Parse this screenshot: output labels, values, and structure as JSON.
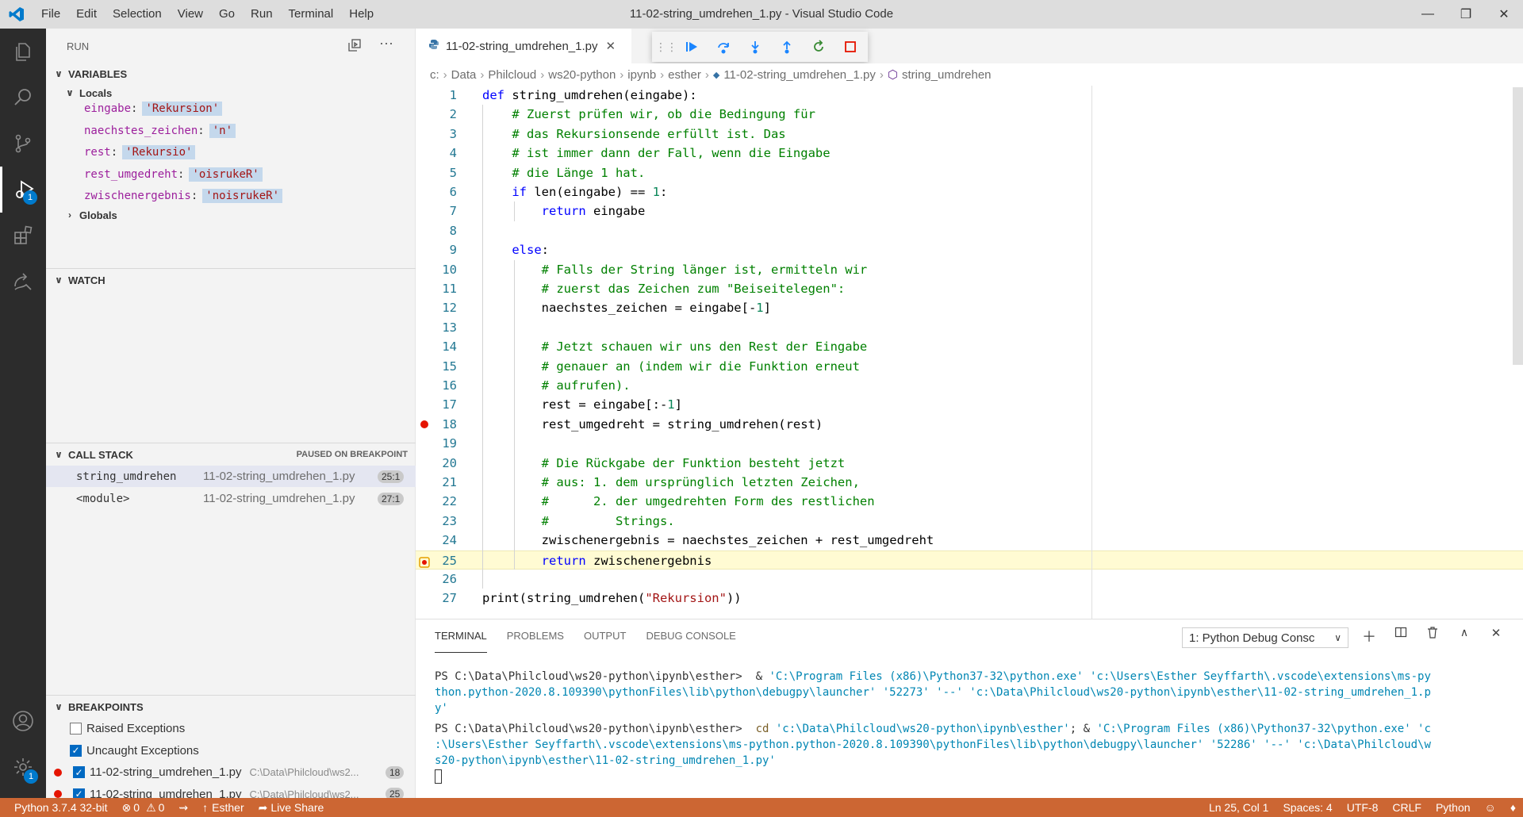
{
  "titlebar": {
    "menu": [
      "File",
      "Edit",
      "Selection",
      "View",
      "Go",
      "Run",
      "Terminal",
      "Help"
    ],
    "title": "11-02-string_umdrehen_1.py - Visual Studio Code"
  },
  "activity": {
    "run_badge": "1",
    "settings_badge": "1"
  },
  "sidebar": {
    "header": "RUN",
    "variables_title": "VARIABLES",
    "locals_label": "Locals",
    "globals_label": "Globals",
    "locals": [
      {
        "name": "eingabe",
        "value": "'Rekursion'"
      },
      {
        "name": "naechstes_zeichen",
        "value": "'n'"
      },
      {
        "name": "rest",
        "value": "'Rekursio'"
      },
      {
        "name": "rest_umgedreht",
        "value": "'oisrukeR'"
      },
      {
        "name": "zwischenergebnis",
        "value": "'noisrukeR'"
      }
    ],
    "watch_title": "WATCH",
    "callstack_title": "CALL STACK",
    "callstack_status": "PAUSED ON BREAKPOINT",
    "callstack": [
      {
        "name": "string_umdrehen",
        "file": "11-02-string_umdrehen_1.py",
        "pos": "25:1"
      },
      {
        "name": "<module>",
        "file": "11-02-string_umdrehen_1.py",
        "pos": "27:1"
      }
    ],
    "breakpoints_title": "BREAKPOINTS",
    "breakpoints": [
      {
        "label": "Raised Exceptions",
        "checked": false
      },
      {
        "label": "Uncaught Exceptions",
        "checked": true
      },
      {
        "label": "11-02-string_umdrehen_1.py",
        "path": "C:\\Data\\Philcloud\\ws2...",
        "line": "18",
        "checked": true
      },
      {
        "label": "11-02-string_umdrehen_1.py",
        "path": "C:\\Data\\Philcloud\\ws2...",
        "line": "25",
        "checked": true
      }
    ]
  },
  "editor": {
    "tab_label": "11-02-string_umdrehen_1.py",
    "breadcrumb": [
      "c:",
      "Data",
      "Philcloud",
      "ws20-python",
      "ipynb",
      "esther",
      "11-02-string_umdrehen_1.py",
      "string_umdrehen"
    ],
    "breakpoint_line": 18,
    "current_line": 25,
    "lines": [
      "def string_umdrehen(eingabe):",
      "    # Zuerst prüfen wir, ob die Bedingung für",
      "    # das Rekursionsende erfüllt ist. Das",
      "    # ist immer dann der Fall, wenn die Eingabe",
      "    # die Länge 1 hat.",
      "    if len(eingabe) == 1:",
      "        return eingabe",
      "",
      "    else:",
      "        # Falls der String länger ist, ermitteln wir",
      "        # zuerst das Zeichen zum \"Beiseitelegen\":",
      "        naechstes_zeichen = eingabe[-1]",
      "",
      "        # Jetzt schauen wir uns den Rest der Eingabe",
      "        # genauer an (indem wir die Funktion erneut",
      "        # aufrufen).",
      "        rest = eingabe[:-1]",
      "        rest_umgedreht = string_umdrehen(rest)",
      "",
      "        # Die Rückgabe der Funktion besteht jetzt",
      "        # aus: 1. dem ursprünglich letzten Zeichen,",
      "        #      2. der umgedrehten Form des restlichen",
      "        #         Strings.",
      "        zwischenergebnis = naechstes_zeichen + rest_umgedreht",
      "        return zwischenergebnis",
      "",
      "print(string_umdrehen(\"Rekursion\"))"
    ]
  },
  "panel": {
    "tabs": [
      "TERMINAL",
      "PROBLEMS",
      "OUTPUT",
      "DEBUG CONSOLE"
    ],
    "terminal_select": "1: Python Debug Consc",
    "terminal_lines": [
      [
        {
          "t": "PS C:\\Data\\Philcloud\\ws20-python\\ipynb\\esther>  & ",
          "c": ""
        },
        {
          "t": "'C:\\Program Files (x86)\\Python37-32\\python.exe' 'c:\\Users\\Esther Seyffarth\\.vscode\\extensions\\ms-py",
          "c": "t-str"
        }
      ],
      [
        {
          "t": "thon.python-2020.8.109390\\pythonFiles\\lib\\python\\debugpy\\launcher' '52273' '--' 'c:\\Data\\Philcloud\\ws20-python\\ipynb\\esther\\11-02-string_umdrehen_1.p",
          "c": "t-str"
        }
      ],
      [
        {
          "t": "y'",
          "c": "t-str"
        }
      ],
      [
        {
          "t": "PS C:\\Data\\Philcloud\\ws20-python\\ipynb\\esther>  ",
          "c": ""
        },
        {
          "t": "cd ",
          "c": "t-cmd"
        },
        {
          "t": "'c:\\Data\\Philcloud\\ws20-python\\ipynb\\esther'",
          "c": "t-str"
        },
        {
          "t": "; & ",
          "c": ""
        },
        {
          "t": "'C:\\Program Files (x86)\\Python37-32\\python.exe' 'c",
          "c": "t-str"
        }
      ],
      [
        {
          "t": ":\\Users\\Esther Seyffarth\\.vscode\\extensions\\ms-python.python-2020.8.109390\\pythonFiles\\lib\\python\\debugpy\\launcher' '52286' '--' 'c:\\Data\\Philcloud\\w",
          "c": "t-str"
        }
      ],
      [
        {
          "t": "s20-python\\ipynb\\esther\\11-02-string_umdrehen_1.py'",
          "c": "t-str"
        }
      ]
    ]
  },
  "statusbar": {
    "python": "Python 3.7.4 32-bit",
    "errors": "0",
    "warnings": "0",
    "user": "Esther",
    "liveshare": "Live Share",
    "position": "Ln 25, Col 1",
    "spaces": "Spaces: 4",
    "encoding": "UTF-8",
    "eol": "CRLF",
    "language": "Python"
  }
}
